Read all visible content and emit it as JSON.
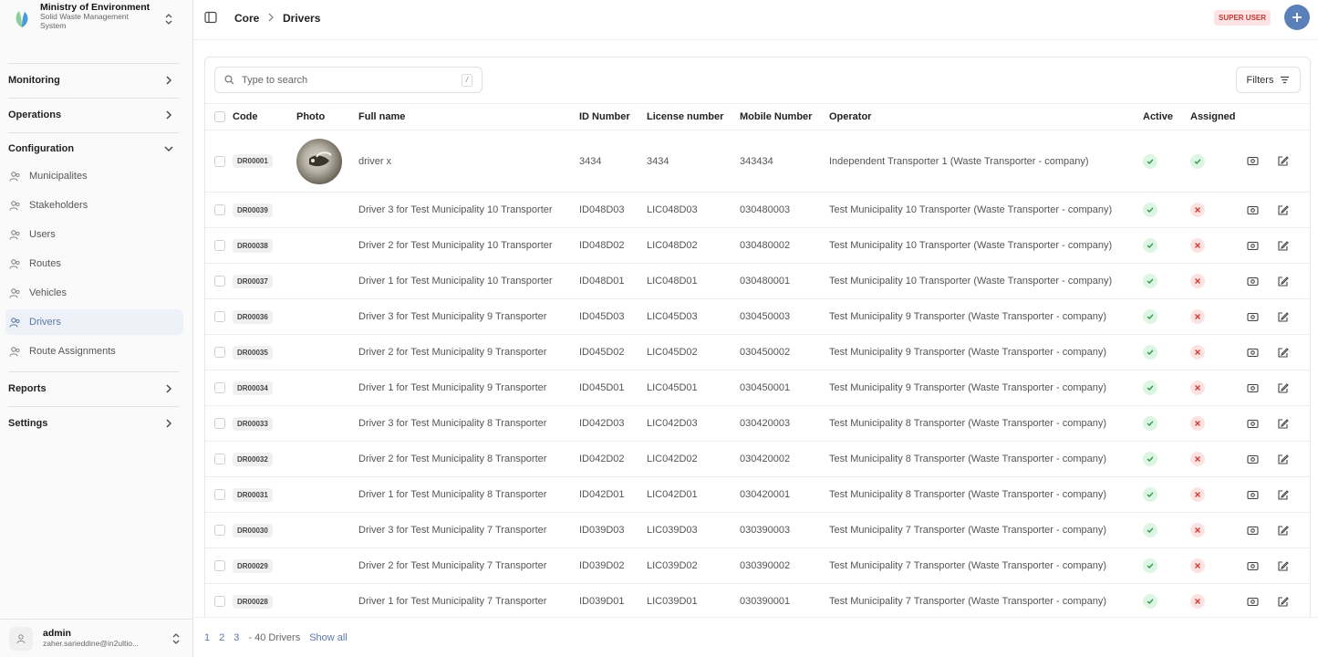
{
  "sidebar": {
    "org_name": "Ministry of Environment",
    "org_sub": "Solid Waste Management System",
    "groups": {
      "monitoring": "Monitoring",
      "operations": "Operations",
      "configuration": "Configuration",
      "reports": "Reports",
      "settings": "Settings"
    },
    "items": [
      "Municipalites",
      "Stakeholders",
      "Users",
      "Routes",
      "Vehicles",
      "Drivers",
      "Route Assignments"
    ],
    "active_item": "Drivers",
    "user": {
      "name": "admin",
      "email": "zaher.sarieddine@in2ultio..."
    }
  },
  "header": {
    "crumbs": [
      "Core",
      "Drivers"
    ],
    "role_badge": "SUPER USER",
    "accent": "#5b7fb9"
  },
  "search": {
    "placeholder": "Type to search",
    "shortcut": "/"
  },
  "filters_label": "Filters",
  "table": {
    "columns": [
      "Code",
      "Photo",
      "Full name",
      "ID Number",
      "License number",
      "Mobile Number",
      "Operator",
      "Active",
      "Assigned"
    ],
    "rows": [
      {
        "code": "DR00001",
        "name": "driver x",
        "id": "3434",
        "license": "3434",
        "mobile": "343434",
        "operator": "Independent Transporter 1 (Waste Transporter - company)",
        "active": true,
        "assigned": true,
        "photo": true
      },
      {
        "code": "DR00039",
        "name": "Driver 3 for Test Municipality 10 Transporter",
        "id": "ID048D03",
        "license": "LIC048D03",
        "mobile": "030480003",
        "operator": "Test Municipality 10 Transporter (Waste Transporter - company)",
        "active": true,
        "assigned": false
      },
      {
        "code": "DR00038",
        "name": "Driver 2 for Test Municipality 10 Transporter",
        "id": "ID048D02",
        "license": "LIC048D02",
        "mobile": "030480002",
        "operator": "Test Municipality 10 Transporter (Waste Transporter - company)",
        "active": true,
        "assigned": false
      },
      {
        "code": "DR00037",
        "name": "Driver 1 for Test Municipality 10 Transporter",
        "id": "ID048D01",
        "license": "LIC048D01",
        "mobile": "030480001",
        "operator": "Test Municipality 10 Transporter (Waste Transporter - company)",
        "active": true,
        "assigned": false
      },
      {
        "code": "DR00036",
        "name": "Driver 3 for Test Municipality 9 Transporter",
        "id": "ID045D03",
        "license": "LIC045D03",
        "mobile": "030450003",
        "operator": "Test Municipality 9 Transporter (Waste Transporter - company)",
        "active": true,
        "assigned": false
      },
      {
        "code": "DR00035",
        "name": "Driver 2 for Test Municipality 9 Transporter",
        "id": "ID045D02",
        "license": "LIC045D02",
        "mobile": "030450002",
        "operator": "Test Municipality 9 Transporter (Waste Transporter - company)",
        "active": true,
        "assigned": false
      },
      {
        "code": "DR00034",
        "name": "Driver 1 for Test Municipality 9 Transporter",
        "id": "ID045D01",
        "license": "LIC045D01",
        "mobile": "030450001",
        "operator": "Test Municipality 9 Transporter (Waste Transporter - company)",
        "active": true,
        "assigned": false
      },
      {
        "code": "DR00033",
        "name": "Driver 3 for Test Municipality 8 Transporter",
        "id": "ID042D03",
        "license": "LIC042D03",
        "mobile": "030420003",
        "operator": "Test Municipality 8 Transporter (Waste Transporter - company)",
        "active": true,
        "assigned": false
      },
      {
        "code": "DR00032",
        "name": "Driver 2 for Test Municipality 8 Transporter",
        "id": "ID042D02",
        "license": "LIC042D02",
        "mobile": "030420002",
        "operator": "Test Municipality 8 Transporter (Waste Transporter - company)",
        "active": true,
        "assigned": false
      },
      {
        "code": "DR00031",
        "name": "Driver 1 for Test Municipality 8 Transporter",
        "id": "ID042D01",
        "license": "LIC042D01",
        "mobile": "030420001",
        "operator": "Test Municipality 8 Transporter (Waste Transporter - company)",
        "active": true,
        "assigned": false
      },
      {
        "code": "DR00030",
        "name": "Driver 3 for Test Municipality 7 Transporter",
        "id": "ID039D03",
        "license": "LIC039D03",
        "mobile": "030390003",
        "operator": "Test Municipality 7 Transporter (Waste Transporter - company)",
        "active": true,
        "assigned": false
      },
      {
        "code": "DR00029",
        "name": "Driver 2 for Test Municipality 7 Transporter",
        "id": "ID039D02",
        "license": "LIC039D02",
        "mobile": "030390002",
        "operator": "Test Municipality 7 Transporter (Waste Transporter - company)",
        "active": true,
        "assigned": false
      },
      {
        "code": "DR00028",
        "name": "Driver 1 for Test Municipality 7 Transporter",
        "id": "ID039D01",
        "license": "LIC039D01",
        "mobile": "030390001",
        "operator": "Test Municipality 7 Transporter (Waste Transporter - company)",
        "active": true,
        "assigned": false
      }
    ]
  },
  "pagination": {
    "pages": [
      "1",
      "2",
      "3"
    ],
    "total": "- 40 Drivers",
    "show_all": "Show all"
  }
}
